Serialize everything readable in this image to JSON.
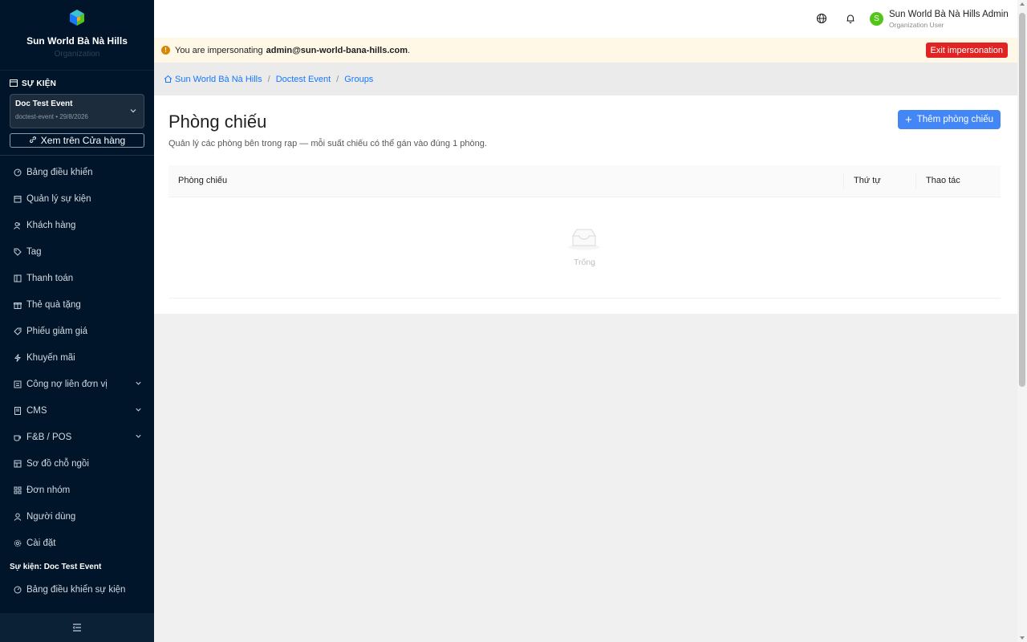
{
  "sidebar": {
    "brand_name": "Sun World Bà Nà Hills",
    "brand_sub": "Organization",
    "section_title": "SỰ KIỆN",
    "event": {
      "name": "Doc Test Event",
      "meta": "doctest-event • 29/8/2026"
    },
    "store_button": "Xem trên Cửa hàng",
    "items": [
      {
        "label": "Bảng điều khiển",
        "icon": "dashboard-icon"
      },
      {
        "label": "Quản lý sự kiện",
        "icon": "calendar-icon"
      },
      {
        "label": "Khách hàng",
        "icon": "users-icon"
      },
      {
        "label": "Tag",
        "icon": "tag-icon"
      },
      {
        "label": "Thanh toán",
        "icon": "payment-icon"
      },
      {
        "label": "Thẻ quà tặng",
        "icon": "gift-icon"
      },
      {
        "label": "Phiếu giảm giá",
        "icon": "coupon-icon"
      },
      {
        "label": "Khuyến mãi",
        "icon": "bolt-icon"
      },
      {
        "label": "Công nợ liên đơn vị",
        "icon": "ledger-icon"
      },
      {
        "label": "CMS",
        "icon": "document-icon"
      },
      {
        "label": "F&B / POS",
        "icon": "coffee-icon"
      },
      {
        "label": "Sơ đồ chỗ ngồi",
        "icon": "seat-map-icon"
      },
      {
        "label": "Đơn nhóm",
        "icon": "grid-icon"
      },
      {
        "label": "Người dùng",
        "icon": "user-icon"
      },
      {
        "label": "Cài đặt",
        "icon": "settings-icon"
      }
    ],
    "event_group_title": "Sự kiện: Doc Test Event",
    "event_items": [
      {
        "label": "Bảng điều khiển sự kiện",
        "icon": "dashboard-icon"
      }
    ]
  },
  "header": {
    "avatar_letter": "S",
    "user_name": "Sun World Bà Nà Hills Admin",
    "user_role": "Organization User"
  },
  "banner": {
    "text": "You are impersonating",
    "email": "admin@sun-world-bana-hills.com",
    "suffix": ".",
    "exit_label": "Exit impersonation"
  },
  "breadcrumb": [
    "Sun World Bà Nà Hills",
    "Doctest Event",
    "Groups"
  ],
  "page": {
    "title": "Phòng chiếu",
    "description": "Quản lý các phòng bên trong rạp — mỗi suất chiếu có thể gán vào đúng 1 phòng.",
    "add_button": "Thêm phòng chiếu",
    "columns": [
      "Phòng chiếu",
      "Thứ tự",
      "Thao tác"
    ],
    "empty_text": "Trống"
  },
  "colors": {
    "sidebar_bg": "#001529",
    "primary": "#4287f5",
    "danger": "#e02424",
    "banner_bg": "#fff8e6",
    "avatar": "#52c41a"
  }
}
